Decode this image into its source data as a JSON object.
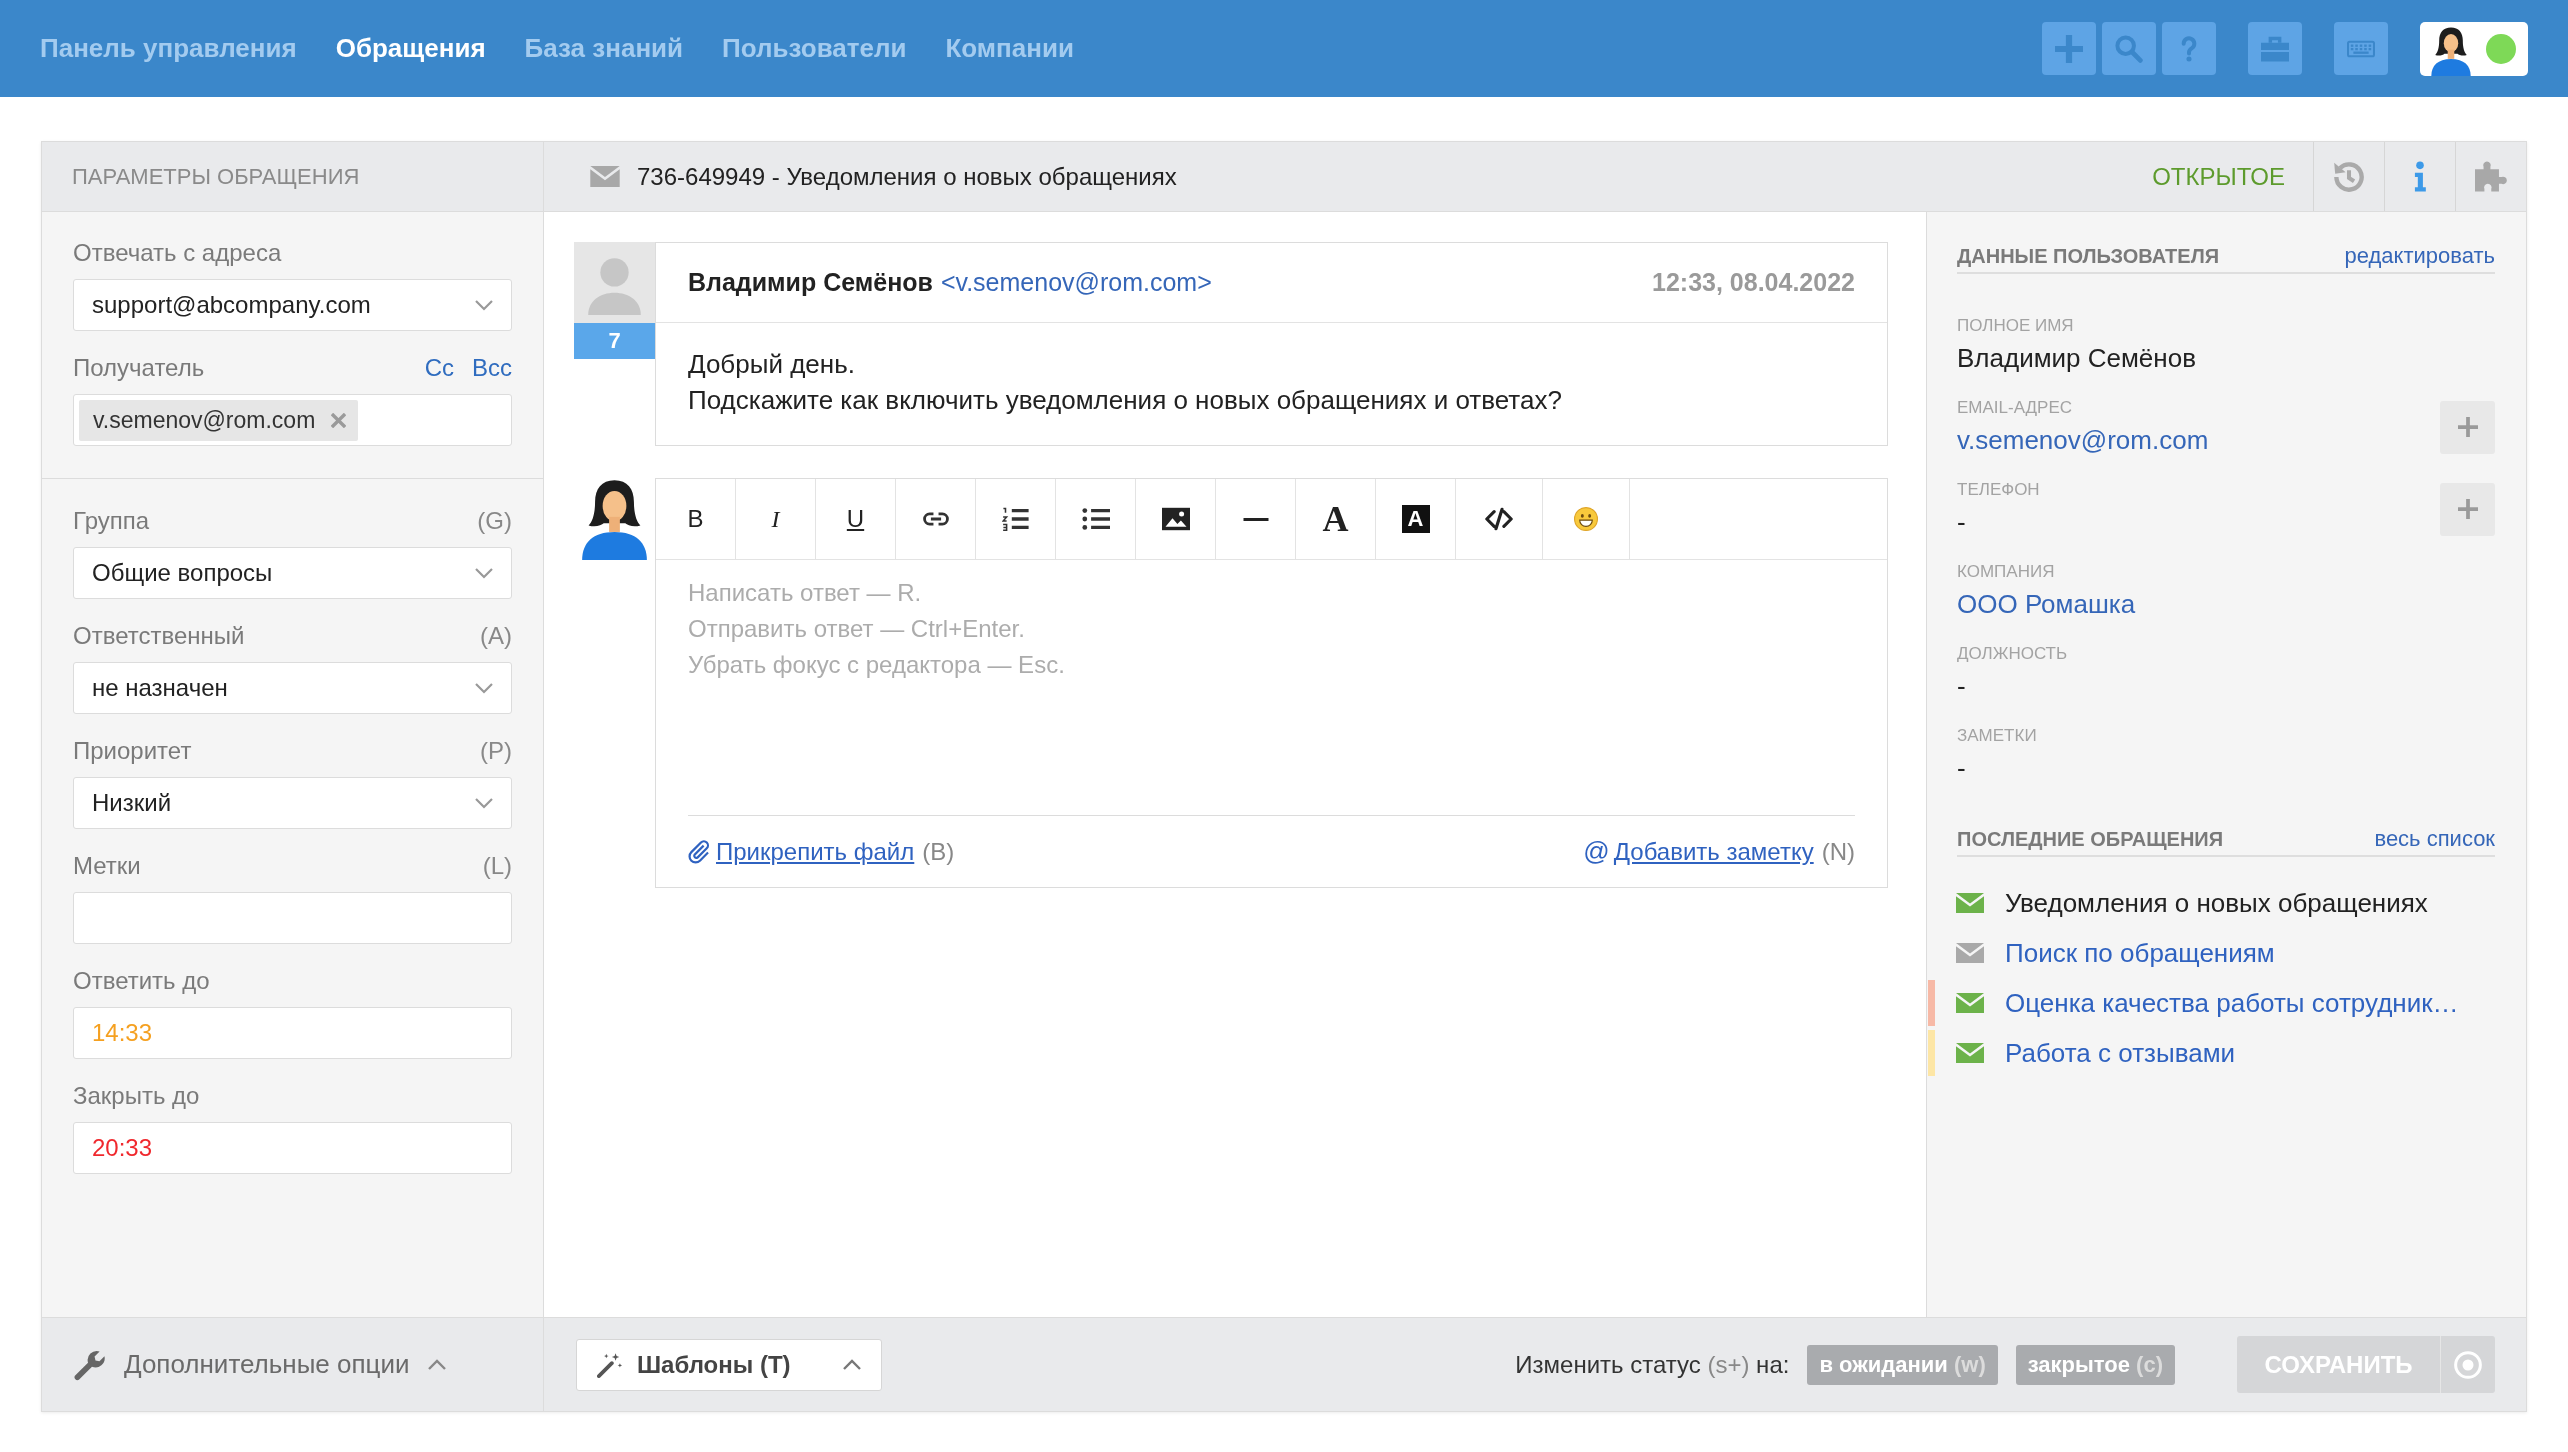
{
  "topbar": {
    "nav": [
      {
        "label": "Панель управления",
        "selected": false
      },
      {
        "label": "Обращения",
        "selected": true
      },
      {
        "label": "База знаний",
        "selected": false
      },
      {
        "label": "Пользователи",
        "selected": false
      },
      {
        "label": "Компании",
        "selected": false
      }
    ],
    "user_online": true
  },
  "params": {
    "title": "ПАРАМЕТРЫ ОБРАЩЕНИЯ",
    "sections": [
      {
        "fields": [
          {
            "kind": "select",
            "label": "Отвечать с адреса",
            "value": "support@abcompany.com"
          },
          {
            "kind": "recipients",
            "label": "Получатель",
            "links": [
              "Cc",
              "Bcc"
            ],
            "tags": [
              "v.semenov@rom.com"
            ]
          }
        ]
      },
      {
        "fields": [
          {
            "kind": "select",
            "label": "Группа",
            "shortcut": "(G)",
            "value": "Общие вопросы"
          },
          {
            "kind": "select",
            "label": "Ответственный",
            "shortcut": "(A)",
            "value": "не назначен"
          },
          {
            "kind": "select",
            "label": "Приоритет",
            "shortcut": "(P)",
            "value": "Низкий"
          },
          {
            "kind": "input",
            "label": "Метки",
            "shortcut": "(L)"
          },
          {
            "kind": "input",
            "label": "Ответить до",
            "value": "14:33",
            "color": "#f5a020"
          },
          {
            "kind": "input",
            "label": "Закрыть до",
            "value": "20:33",
            "color": "#f0282d"
          }
        ]
      }
    ],
    "more_options": "Дополнительные опции"
  },
  "ticket": {
    "subject": "736-649949 - Уведомления о новых обращениях",
    "status": {
      "label": "ОТКРЫТОЕ",
      "kind": "open"
    }
  },
  "message": {
    "author": "Владимир Семёнов",
    "email": "<v.semenov@rom.com>",
    "time": "12:33, 08.04.2022",
    "count": "7",
    "body": [
      "Добрый день.",
      "Подскажите как включить уведомления о новых обращениях и ответах?"
    ]
  },
  "editor": {
    "toolbar": [
      {
        "kind": "bold",
        "glyph": "B"
      },
      {
        "kind": "italic",
        "glyph": "I"
      },
      {
        "kind": "underline",
        "glyph": "U"
      },
      {
        "kind": "link"
      },
      {
        "kind": "numbered-list"
      },
      {
        "kind": "bullet-list"
      },
      {
        "kind": "image"
      },
      {
        "kind": "rule"
      },
      {
        "kind": "text-color",
        "glyph": "A"
      },
      {
        "kind": "highlight",
        "glyph": "A"
      },
      {
        "kind": "code"
      },
      {
        "kind": "emoji"
      }
    ],
    "placeholder": "Написать ответ — R.\nОтправить ответ — Ctrl+Enter.\nУбрать фокус с редактора — Esc.",
    "attach": {
      "link": "Прикрепить файл",
      "shortcut": "(B)"
    },
    "note": {
      "glyph": "@",
      "link": "Добавить заметку",
      "shortcut": "(N)"
    }
  },
  "customer": {
    "title": "ДАННЫЕ ПОЛЬЗОВАТЕЛЯ",
    "edit": "редактировать",
    "fields": [
      {
        "label": "ПОЛНОЕ ИМЯ",
        "value": "Владимир Семёнов",
        "kind": "text",
        "addable": false
      },
      {
        "label": "EMAIL-АДРЕС",
        "value": "v.semenov@rom.com",
        "kind": "link",
        "addable": true
      },
      {
        "label": "ТЕЛЕФОН",
        "value": "-",
        "kind": "text",
        "addable": true
      },
      {
        "label": "КОМПАНИЯ",
        "value": "ООО Ромашка",
        "kind": "link",
        "addable": false
      },
      {
        "label": "ДОЛЖНОСТЬ",
        "value": "-",
        "kind": "text",
        "addable": false
      },
      {
        "label": "ЗАМЕТКИ",
        "value": "-",
        "kind": "text",
        "addable": false
      }
    ]
  },
  "recent": {
    "title": "ПОСЛЕДНИЕ ОБРАЩЕНИЯ",
    "all": "весь список",
    "items": [
      {
        "subject": "Уведомления о новых обращениях",
        "open": true,
        "current": true
      },
      {
        "subject": "Поиск по обращениям",
        "open": false,
        "current": false
      },
      {
        "subject": "Оценка качества работы сотрудник…",
        "open": true,
        "current": false,
        "color": "#f7b9a6"
      },
      {
        "subject": "Работа с отзывами",
        "open": true,
        "current": false,
        "color": "#fde6a5"
      }
    ]
  },
  "actions": {
    "templates": "Шаблоны (T)",
    "status_change": {
      "label": "Изменить статус",
      "shortcut": "(s+)",
      "suffix": "на:",
      "options": [
        {
          "label": "в ожидании",
          "shortcut": "(w)"
        },
        {
          "label": "закрытое",
          "shortcut": "(c)"
        }
      ]
    },
    "save": {
      "label": "СОХРАНИТЬ",
      "disabled": true
    }
  }
}
